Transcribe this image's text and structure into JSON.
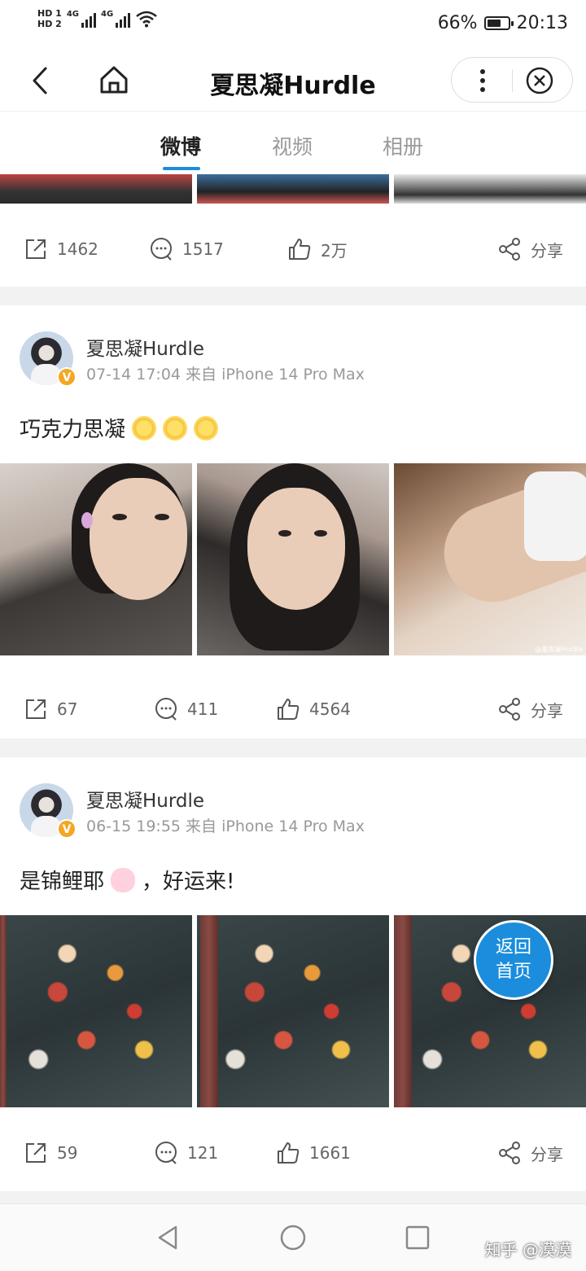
{
  "status_bar": {
    "sim1": "HD 1",
    "sim2": "HD 2",
    "net1": "4G",
    "net2": "4G",
    "battery_percent": "66%",
    "battery_level": 0.66,
    "time": "20:13"
  },
  "nav": {
    "title": "夏思凝Hurdle"
  },
  "tabs": [
    {
      "label": "微博",
      "active": true
    },
    {
      "label": "视频",
      "active": false
    },
    {
      "label": "相册",
      "active": false
    }
  ],
  "posts": [
    {
      "repost_count": "1462",
      "comment_count": "1517",
      "like_count": "2万",
      "share_label": "分享"
    },
    {
      "author": "夏思凝Hurdle",
      "meta": "07-14 17:04 来自 iPhone 14 Pro Max",
      "text": "巧克力思凝",
      "emoji": [
        "sun-emoji",
        "sun-emoji",
        "sun-emoji"
      ],
      "photo_watermark": "@夏思凝Hurdle",
      "repost_count": "67",
      "comment_count": "411",
      "like_count": "4564",
      "share_label": "分享"
    },
    {
      "author": "夏思凝Hurdle",
      "meta": "06-15 19:55 来自 iPhone 14 Pro Max",
      "text_before": "是锦鲤耶",
      "text_after": "，好运来!",
      "emoji": [
        "bunny-emoji"
      ],
      "repost_count": "59",
      "comment_count": "121",
      "like_count": "1661",
      "share_label": "分享"
    }
  ],
  "back_to_top": {
    "line1": "返回",
    "line2": "首页"
  },
  "watermark": "知乎 @漠漠",
  "colors": {
    "accent": "#1b8ddc",
    "badge": "#f5a623"
  }
}
